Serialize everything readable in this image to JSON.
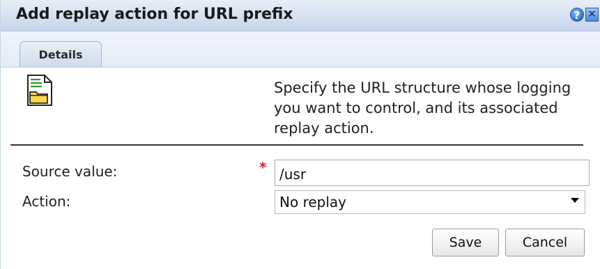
{
  "dialog": {
    "title": "Add replay action for URL prefix",
    "help_glyph": "?",
    "close_glyph": "✕"
  },
  "tabs": [
    {
      "label": "Details",
      "active": true
    }
  ],
  "details": {
    "icon": "document-folder-icon",
    "description": "Specify the URL structure whose logging you want to control, and its associated replay action."
  },
  "form": {
    "source_label": "Source value:",
    "source_required": "*",
    "source_value": "/usr",
    "action_label": "Action:",
    "action_value": "No replay"
  },
  "buttons": {
    "save": "Save",
    "cancel": "Cancel"
  },
  "colors": {
    "title_bar": "#d6e1f1",
    "required": "#d32020"
  }
}
